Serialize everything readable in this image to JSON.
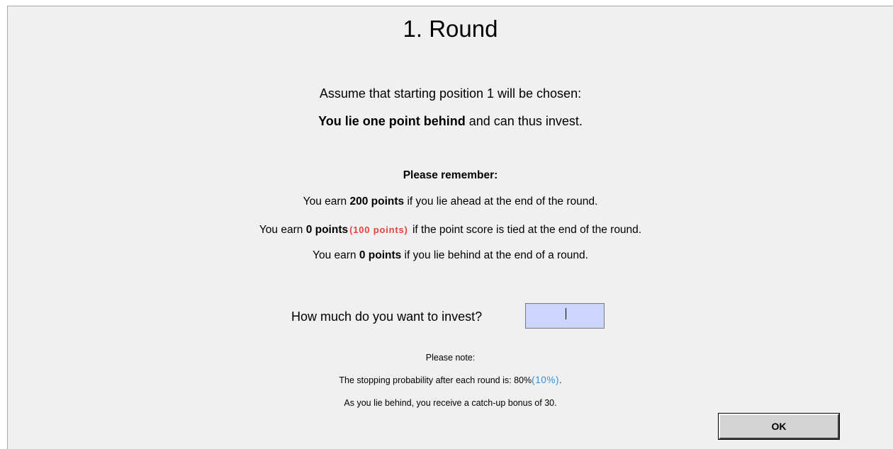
{
  "screen": {
    "title": "1. Round",
    "assumption": "Assume that starting position 1 will be chosen:",
    "position": {
      "bold": "You lie one point behind",
      "rest": " and can thus invest."
    },
    "remember": {
      "heading": "Please remember:",
      "ahead": {
        "pre": "You earn ",
        "bold": "200 points",
        "post": " if you lie ahead at the end of the round."
      },
      "tied": {
        "pre": "You earn ",
        "bold": "0 points",
        "alt": "(100 points)",
        "post": " if the point score is tied at the end of the round."
      },
      "behind": {
        "pre": "You earn ",
        "bold": "0 points",
        "post": " if you lie behind at the end of a round."
      }
    },
    "invest": {
      "label": "How much do you want to invest?",
      "value": ""
    },
    "note": {
      "heading": "Please note:",
      "stopping": {
        "pre": "The stopping probability after each round is: 80%",
        "alt": "(10%)",
        "post": "."
      },
      "bonus": "As you lie behind, you receive a catch-up bonus of 30."
    },
    "ok_label": "OK"
  },
  "colors": {
    "panel_background": "#f0f0f0",
    "input_background": "#ccd5fe",
    "alt_red": "#e8413c",
    "alt_blue": "#2f8fe0",
    "button_face": "#d4d4d4"
  }
}
